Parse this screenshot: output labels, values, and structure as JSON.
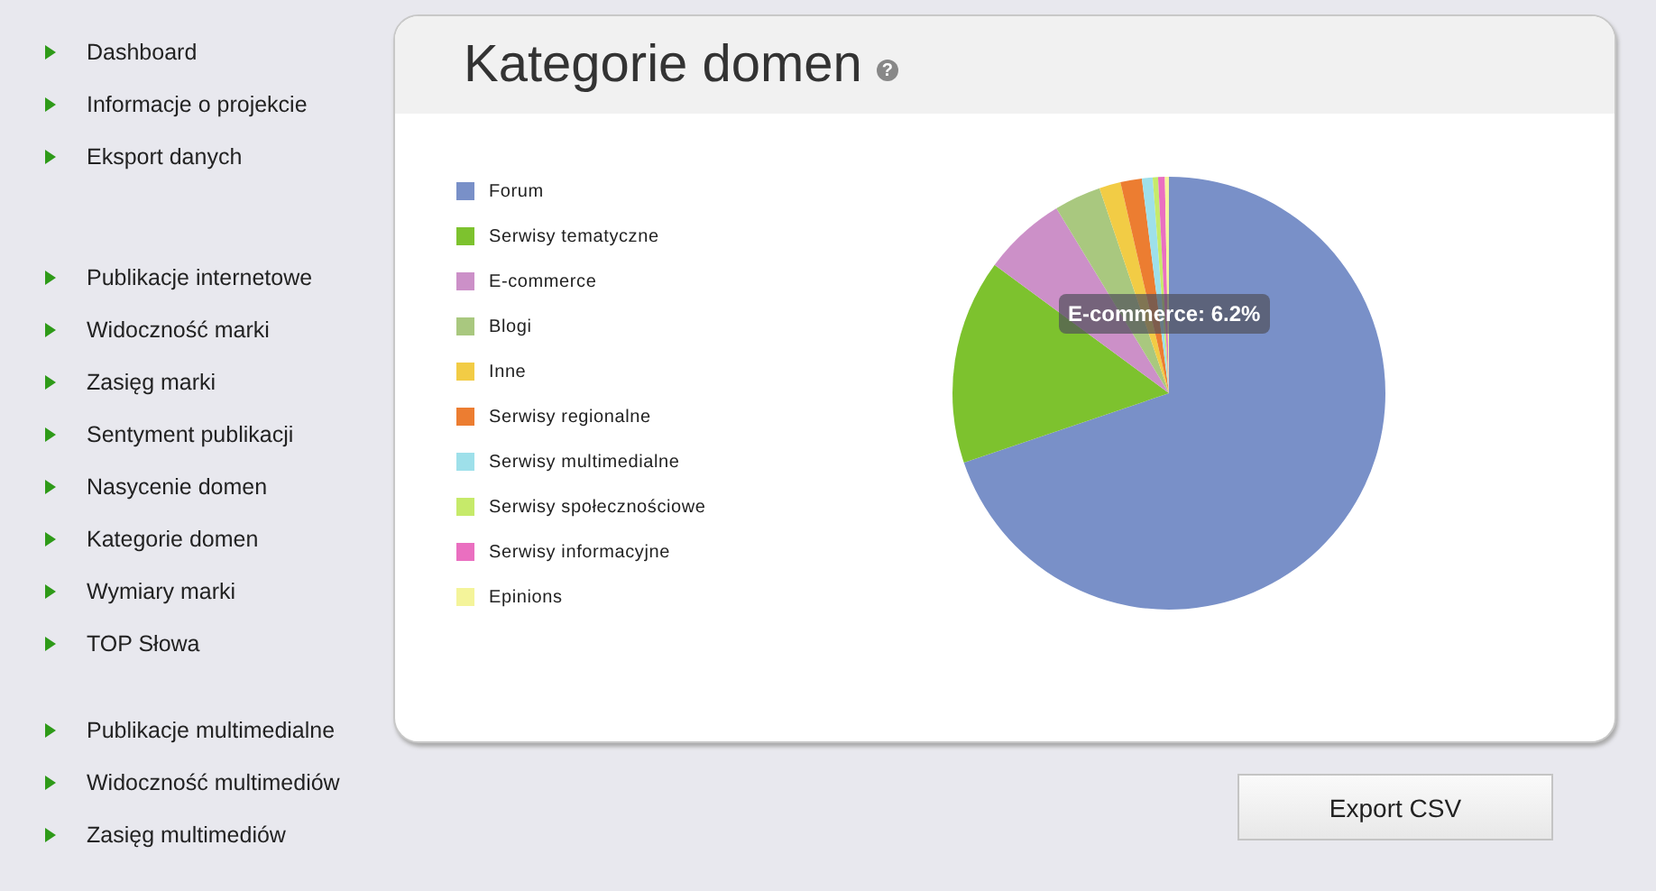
{
  "sidebar": {
    "groups": [
      {
        "items": [
          {
            "label": "Dashboard"
          },
          {
            "label": "Informacje o projekcie"
          },
          {
            "label": "Eksport danych"
          }
        ]
      },
      {
        "items": [
          {
            "label": "Publikacje internetowe"
          },
          {
            "label": "Widoczność marki"
          },
          {
            "label": "Zasięg marki"
          },
          {
            "label": "Sentyment publikacji"
          },
          {
            "label": "Nasycenie domen"
          },
          {
            "label": "Kategorie domen"
          },
          {
            "label": "Wymiary marki"
          },
          {
            "label": "TOP Słowa"
          }
        ]
      },
      {
        "items": [
          {
            "label": "Publikacje multimedialne"
          },
          {
            "label": "Widoczność multimediów"
          },
          {
            "label": "Zasięg multimediów"
          }
        ]
      }
    ]
  },
  "panel": {
    "title": "Kategorie domen",
    "help": "?",
    "legend": [
      {
        "label": "Forum",
        "color": "#7990c8"
      },
      {
        "label": "Serwisy tematyczne",
        "color": "#7dc22e"
      },
      {
        "label": "E-commerce",
        "color": "#cc90c8"
      },
      {
        "label": "Blogi",
        "color": "#a9c87f"
      },
      {
        "label": "Inne",
        "color": "#f2cc45"
      },
      {
        "label": "Serwisy regionalne",
        "color": "#ec7d31"
      },
      {
        "label": "Serwisy multimedialne",
        "color": "#9ee0ea"
      },
      {
        "label": "Serwisy społecznościowe",
        "color": "#c6ea6a"
      },
      {
        "label": "Serwisy informacyjne",
        "color": "#ea6fc0"
      },
      {
        "label": "Epinions",
        "color": "#f4f49a"
      }
    ],
    "tooltip": "E-commerce: 6.2%"
  },
  "buttons": [
    {
      "label": "Export CSV"
    }
  ]
}
